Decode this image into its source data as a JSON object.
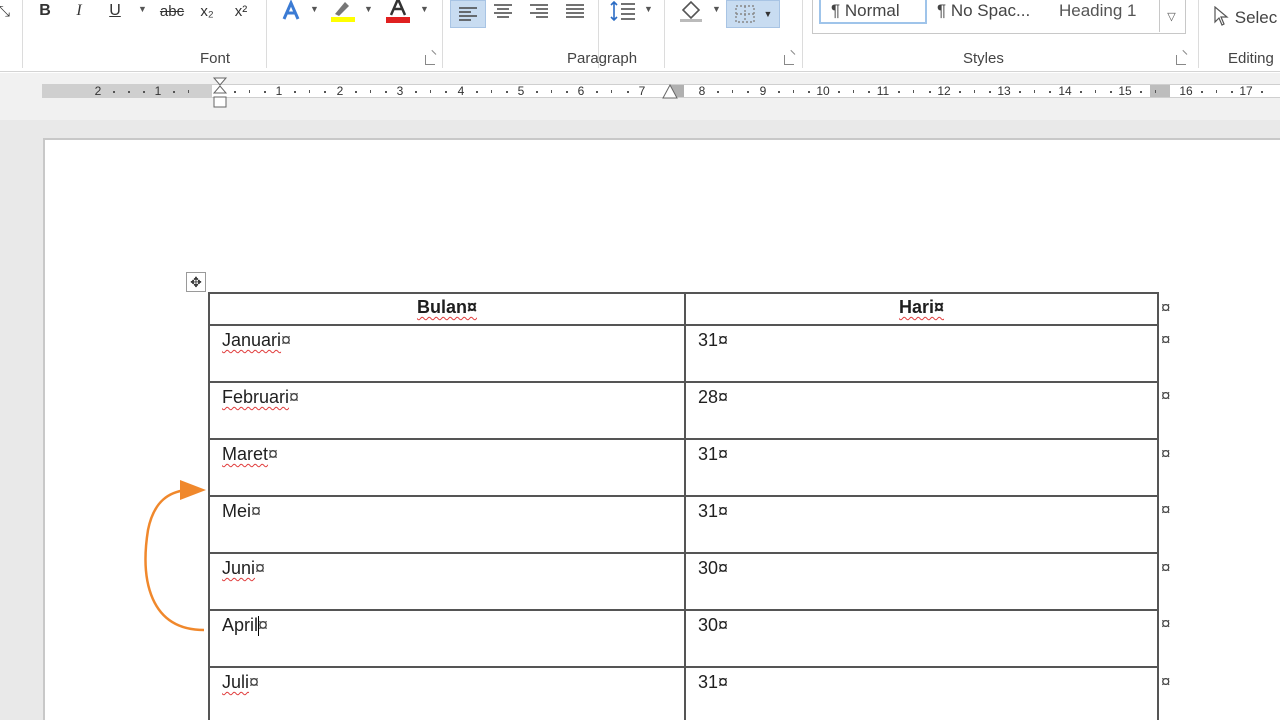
{
  "ribbon": {
    "font": {
      "bold": "B",
      "italic": "I",
      "underline": "U",
      "strikethrough": "abc",
      "subscript": "x₂",
      "superscript": "x²",
      "group_label": "Font"
    },
    "paragraph": {
      "group_label": "Paragraph"
    },
    "styles": {
      "items": [
        "¶ Normal",
        "¶ No Spac...",
        "Heading 1"
      ],
      "group_label": "Styles"
    },
    "editing": {
      "select_label": "Selec",
      "group_label": "Editing"
    },
    "colors": {
      "highlight": "#ffff00",
      "font_color": "#e02020",
      "accent": "#2b579a"
    }
  },
  "ruler": {
    "left_numbers": [
      "2",
      "1"
    ],
    "right_numbers": [
      "1",
      "2",
      "3",
      "4",
      "5",
      "6",
      "7",
      "8",
      "9",
      "10",
      "11",
      "12",
      "13",
      "14",
      "15",
      "16",
      "17"
    ]
  },
  "table": {
    "headers": [
      "Bulan¤",
      "Hari¤"
    ],
    "rows": [
      {
        "month": "Januari",
        "days": "31¤"
      },
      {
        "month": "Februari",
        "days": "28¤"
      },
      {
        "month": "Maret",
        "days": "31¤"
      },
      {
        "month": "Mei",
        "days": "31¤"
      },
      {
        "month": "Juni",
        "days": "30¤"
      },
      {
        "month": "April",
        "days": "30¤"
      },
      {
        "month": "Juli",
        "days": "31¤"
      }
    ],
    "cell_end_mark": "¤",
    "row_end_mark": "¤"
  },
  "annotation": {
    "arrow_color": "#f0882c"
  }
}
